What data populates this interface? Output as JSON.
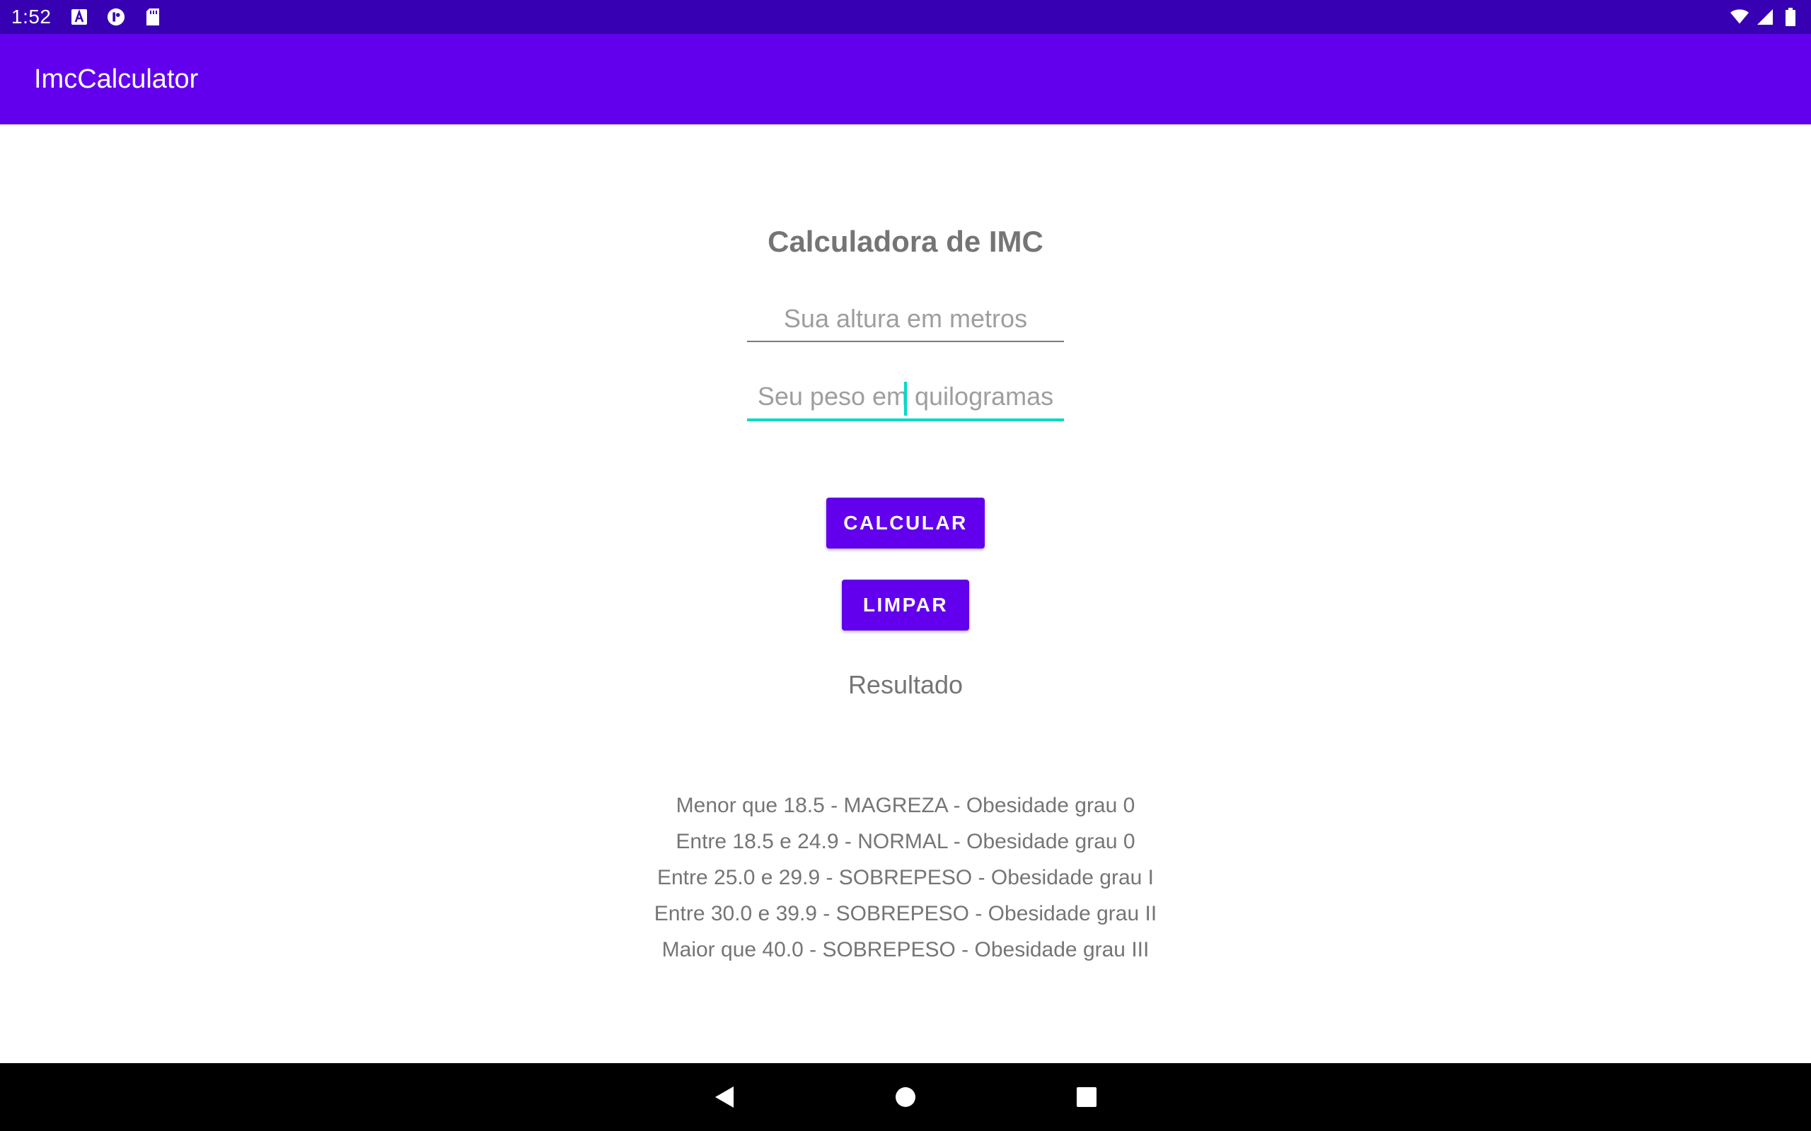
{
  "status_bar": {
    "time": "1:52",
    "left_icons": [
      "a-notification-icon",
      "circle-badge-icon",
      "sd-card-icon"
    ],
    "right_icons": [
      "wifi-icon",
      "cell-signal-icon",
      "battery-icon"
    ]
  },
  "app_bar": {
    "title": "ImcCalculator"
  },
  "main": {
    "heading": "Calculadora de IMC",
    "height_field": {
      "value": "",
      "placeholder": "Sua altura em metros"
    },
    "weight_field": {
      "value": "",
      "placeholder": "Seu peso em quilogramas"
    },
    "calculate_label": "CALCULAR",
    "clear_label": "LIMPAR",
    "result_label": "Resultado",
    "ranges": [
      "Menor que 18.5 - MAGREZA - Obesidade grau 0",
      "Entre 18.5 e 24.9 - NORMAL - Obesidade grau 0",
      "Entre 25.0 e 29.9 - SOBREPESO - Obesidade grau I",
      "Entre 30.0 e 39.9 - SOBREPESO - Obesidade grau II",
      "Maior que 40.0 - SOBREPESO - Obesidade grau III"
    ]
  },
  "nav_bar": {
    "icons": [
      "back-icon",
      "home-icon",
      "recents-icon"
    ]
  },
  "colors": {
    "status_bar": "#3700b3",
    "primary": "#6200ee",
    "accent": "#03dac5",
    "text_secondary": "#757575"
  }
}
